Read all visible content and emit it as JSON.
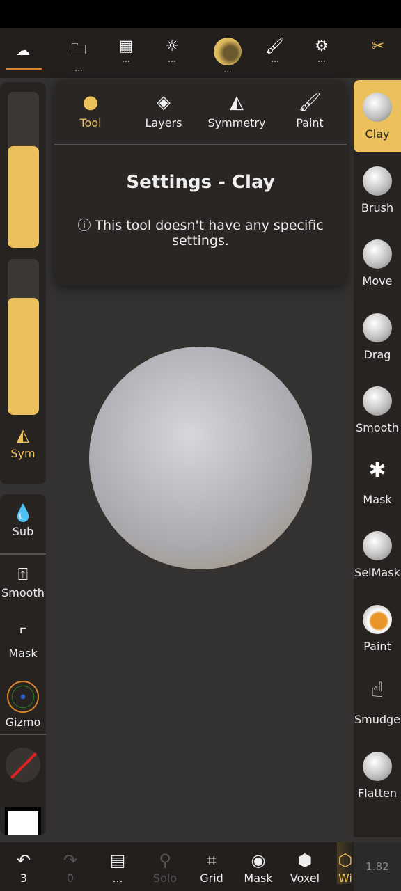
{
  "topbar": {
    "items": [
      {
        "icon": "scene-icon"
      },
      {
        "icon": "folder-icon",
        "dots": "..."
      },
      {
        "icon": "gold-bars-icon",
        "dots": "..."
      },
      {
        "icon": "sun-icon",
        "dots": "..."
      },
      {
        "icon": "clay-ball-icon",
        "dots": "..."
      },
      {
        "icon": "brush-icon",
        "dots": "..."
      },
      {
        "icon": "gear-icon",
        "dots": "..."
      },
      {
        "icon": "tools-icon"
      }
    ]
  },
  "left": {
    "slider1_level": 0.65,
    "slider2_level": 0.75,
    "sym": "Sym",
    "sub": "Sub",
    "smooth": "Smooth",
    "mask": "Mask",
    "gizmo": "Gizmo"
  },
  "popup": {
    "tabs": [
      "Tool",
      "Layers",
      "Symmetry",
      "Paint"
    ],
    "title": "Settings - Clay",
    "info": "This tool doesn't have any specific settings."
  },
  "tools": [
    "Clay",
    "Brush",
    "Move",
    "Drag",
    "Smooth",
    "Mask",
    "SelMask",
    "Paint",
    "Smudge",
    "Flatten"
  ],
  "bottom": {
    "undo": "3",
    "redo": "0",
    "menu": "...",
    "solo": "Solo",
    "grid": "Grid",
    "mask": "Mask",
    "voxel": "Voxel",
    "wire": "Wi",
    "version": "1.82"
  },
  "colors": {
    "accent": "#ecc05a",
    "active_orange": "#d8842c"
  }
}
